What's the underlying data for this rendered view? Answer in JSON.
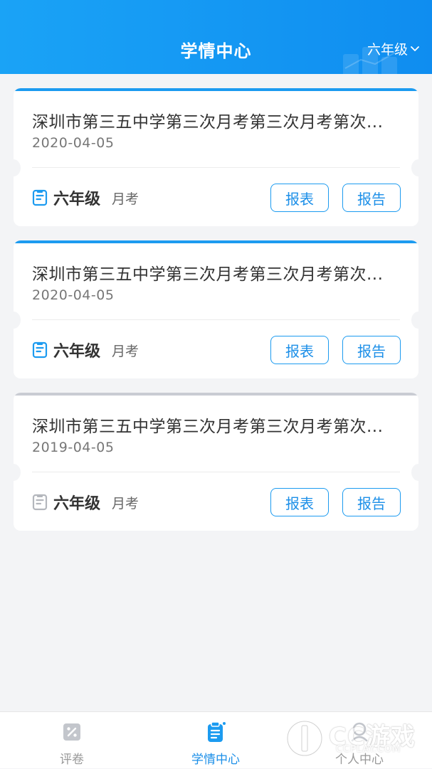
{
  "header": {
    "title": "学情中心",
    "grade_selector": "六年级"
  },
  "cards": [
    {
      "state": "active",
      "title": "深圳市第三五中学第三次月考第三次月考第次...",
      "date": "2020-04-05",
      "grade": "六年级",
      "type": "月考",
      "btn_table": "报表",
      "btn_report": "报告"
    },
    {
      "state": "active",
      "title": "深圳市第三五中学第三次月考第三次月考第次...",
      "date": "2020-04-05",
      "grade": "六年级",
      "type": "月考",
      "btn_table": "报表",
      "btn_report": "报告"
    },
    {
      "state": "inactive",
      "title": "深圳市第三五中学第三次月考第三次月考第次...",
      "date": "2019-04-05",
      "grade": "六年级",
      "type": "月考",
      "btn_table": "报表",
      "btn_report": "报告"
    }
  ],
  "tabbar": {
    "items": [
      {
        "label": "评卷",
        "icon": "grading-icon",
        "active": false
      },
      {
        "label": "学情中心",
        "icon": "clipboard-icon",
        "active": true
      },
      {
        "label": "个人中心",
        "icon": "profile-icon",
        "active": false
      }
    ]
  },
  "watermark": {
    "text": "CC游戏",
    "url": "CCPLAY.COM"
  },
  "colors": {
    "accent": "#1c9bf0",
    "header_gradient_start": "#1aa3f6",
    "header_gradient_end": "#0f8df0",
    "inactive_line": "#c9ccd3",
    "background": "#f3f4f6"
  }
}
